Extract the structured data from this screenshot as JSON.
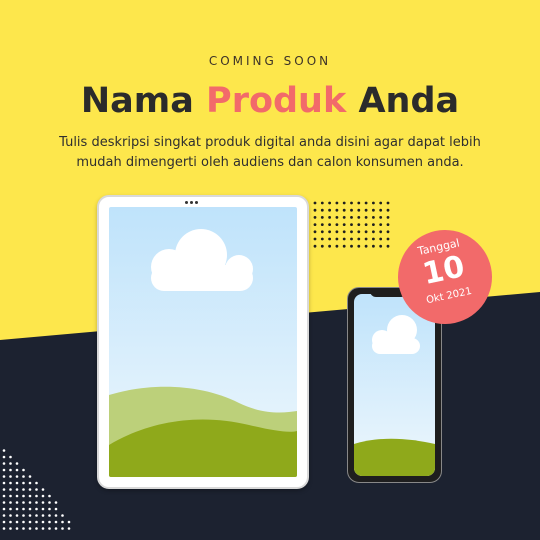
{
  "header": {
    "eyebrow": "COMING SOON",
    "title_part1": "Nama ",
    "title_accent": "Produk",
    "title_part2": " Anda",
    "description": "Tulis deskripsi singkat produk digital anda disini agar dapat lebih mudah dimengerti oleh audiens dan calon konsumen anda."
  },
  "badge": {
    "label": "Tanggal",
    "day": "10",
    "month_year": "Okt 2021"
  },
  "colors": {
    "background_yellow": "#fde74c",
    "background_dark": "#1c2230",
    "accent_coral": "#f26a6a",
    "sky": "#bfe3fb",
    "hill_light": "#bcd07a",
    "hill_dark": "#8fa91b"
  },
  "icons": {
    "dots_top": "dot-grid-pattern",
    "dots_bottom": "dot-grid-pattern",
    "cloud": "cloud-shape"
  }
}
